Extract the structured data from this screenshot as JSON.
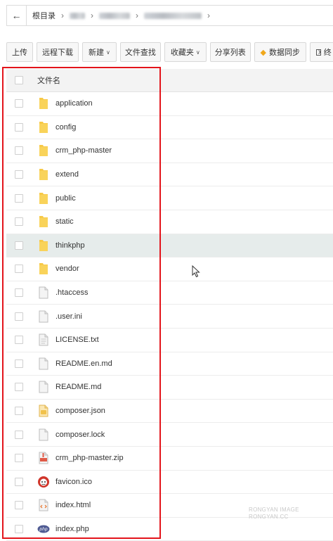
{
  "breadcrumb": {
    "root": "根目录"
  },
  "toolbar": {
    "upload": "上传",
    "remote_download": "远程下载",
    "new": "新建",
    "file_search": "文件查找",
    "favorites": "收藏夹",
    "share_list": "分享列表",
    "data_sync": "数据同步",
    "terminal_partial": "终"
  },
  "list": {
    "header": "文件名",
    "items": [
      {
        "name": "application",
        "icon": "folder-icon"
      },
      {
        "name": "config",
        "icon": "folder-icon"
      },
      {
        "name": "crm_php-master",
        "icon": "folder-icon"
      },
      {
        "name": "extend",
        "icon": "folder-icon"
      },
      {
        "name": "public",
        "icon": "folder-icon"
      },
      {
        "name": "static",
        "icon": "folder-icon"
      },
      {
        "name": "thinkphp",
        "icon": "folder-icon"
      },
      {
        "name": "vendor",
        "icon": "folder-icon"
      },
      {
        "name": ".htaccess",
        "icon": "file-icon"
      },
      {
        "name": ".user.ini",
        "icon": "file-icon"
      },
      {
        "name": "LICENSE.txt",
        "icon": "text-file-icon"
      },
      {
        "name": "README.en.md",
        "icon": "file-icon"
      },
      {
        "name": "README.md",
        "icon": "file-icon"
      },
      {
        "name": "composer.json",
        "icon": "json-file-icon"
      },
      {
        "name": "composer.lock",
        "icon": "file-icon"
      },
      {
        "name": "crm_php-master.zip",
        "icon": "zip-file-icon"
      },
      {
        "name": "favicon.ico",
        "icon": "favicon-icon"
      },
      {
        "name": "index.html",
        "icon": "html-file-icon"
      },
      {
        "name": "index.php",
        "icon": "php-file-icon"
      }
    ]
  },
  "watermark": {
    "line1": "RONGYAN IMAGE",
    "line2": "RONGYAN.CC"
  },
  "colors": {
    "folder": "#f7c948",
    "highlight_box": "#e3141b",
    "hover_row": "#e6eceb"
  }
}
